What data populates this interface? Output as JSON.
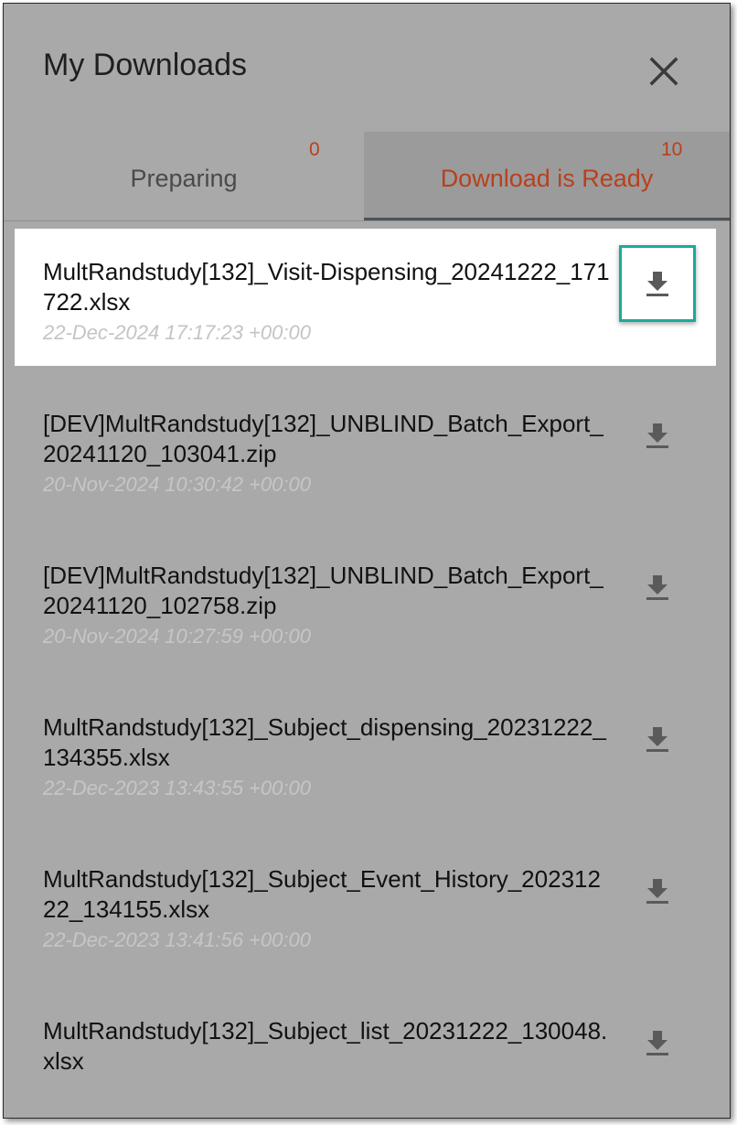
{
  "header": {
    "title": "My Downloads",
    "close_icon": "close-icon"
  },
  "tabs": [
    {
      "label": "Preparing",
      "count": "0",
      "active": false
    },
    {
      "label": "Download is Ready",
      "count": "10",
      "active": true
    }
  ],
  "colors": {
    "accent_orange": "#b8401d",
    "selection_teal": "#1aab99",
    "overlay_gray": "#a9a9a9"
  },
  "downloads": [
    {
      "name": "MultRandstudy[132]_Visit-Dispensing_20241222_171722.xlsx",
      "timestamp": "22-Dec-2024 17:17:23 +00:00",
      "icon": "download-icon",
      "selected": true
    },
    {
      "name": "[DEV]MultRandstudy[132]_UNBLIND_Batch_Export_20241120_103041.zip",
      "timestamp": "20-Nov-2024 10:30:42 +00:00",
      "icon": "download-icon",
      "selected": false
    },
    {
      "name": "[DEV]MultRandstudy[132]_UNBLIND_Batch_Export_20241120_102758.zip",
      "timestamp": "20-Nov-2024 10:27:59 +00:00",
      "icon": "download-icon",
      "selected": false
    },
    {
      "name": "MultRandstudy[132]_Subject_dispensing_20231222_134355.xlsx",
      "timestamp": "22-Dec-2023 13:43:55 +00:00",
      "icon": "download-icon",
      "selected": false
    },
    {
      "name": "MultRandstudy[132]_Subject_Event_History_20231222_134155.xlsx",
      "timestamp": "22-Dec-2023 13:41:56 +00:00",
      "icon": "download-icon",
      "selected": false
    },
    {
      "name": "MultRandstudy[132]_Subject_list_20231222_130048.xlsx",
      "timestamp": "",
      "icon": "download-icon",
      "selected": false
    }
  ]
}
